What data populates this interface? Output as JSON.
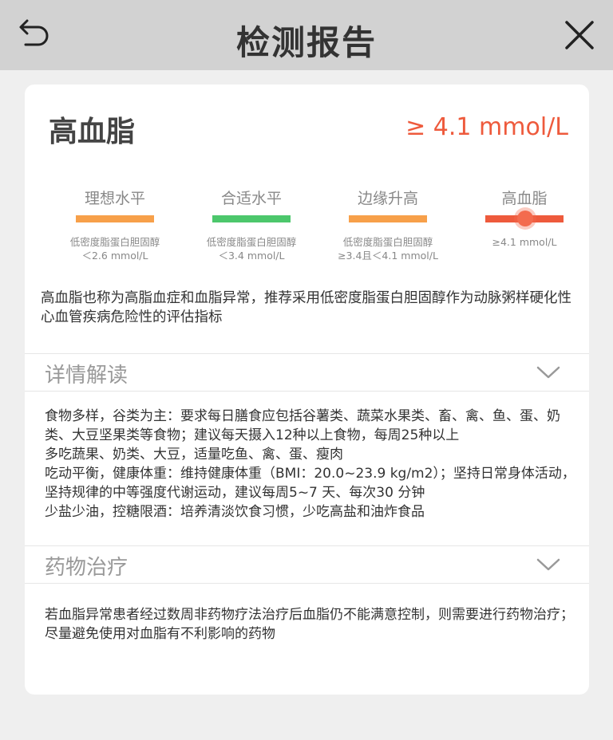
{
  "header": {
    "title": "检测报告",
    "back_icon": "back-arrow-icon",
    "close_icon": "close-icon"
  },
  "condition": {
    "name": "高血脂",
    "value": "≥ 4.1 mmol/L",
    "value_color": "#ee5a3c"
  },
  "levels": [
    {
      "name": "理想水平",
      "color": "#f7a04a",
      "line1": "低密度脂蛋白胆固醇",
      "line2": "＜2.6 mmol/L"
    },
    {
      "name": "合适水平",
      "color": "#4cc76c",
      "line1": "低密度脂蛋白胆固醇",
      "line2": "＜3.4 mmol/L"
    },
    {
      "name": "边缘升高",
      "color": "#f7a04a",
      "line1": "低密度脂蛋白胆固醇",
      "line2": "≥3.4且＜4.1 mmol/L"
    },
    {
      "name": "高血脂",
      "color": "#ee5a3c",
      "line1": "≥4.1 mmol/L",
      "line2": "",
      "current": true
    }
  ],
  "description": "高血脂也称为高脂血症和血脂异常，推荐采用低密度脂蛋白胆固醇作为动脉粥样硬化性心血管疾病危险性的评估指标",
  "details": {
    "title": "详情解读",
    "lines": [
      "食物多样，谷类为主：要求每日膳食应包括谷薯类、蔬菜水果类、畜、禽、鱼、蛋、奶类、大豆坚果类等食物；建议每天摄入12种以上食物，每周25种以上",
      "多吃蔬果、奶类、大豆，适量吃鱼、禽、蛋、瘦肉",
      "吃动平衡，健康体重：维持健康体重（BMI：20.0~23.9 kg/m2）；坚持日常身体活动，坚持规律的中等强度代谢运动，建议每周5~7 天、每次30 分钟",
      "少盐少油，控糖限酒：培养清淡饮食习惯，少吃高盐和油炸食品"
    ]
  },
  "medication": {
    "title": "药物治疗",
    "text": "若血脂异常患者经过数周非药物疗法治疗后血脂仍不能满意控制，则需要进行药物治疗；尽量避免使用对血脂有不利影响的药物"
  }
}
